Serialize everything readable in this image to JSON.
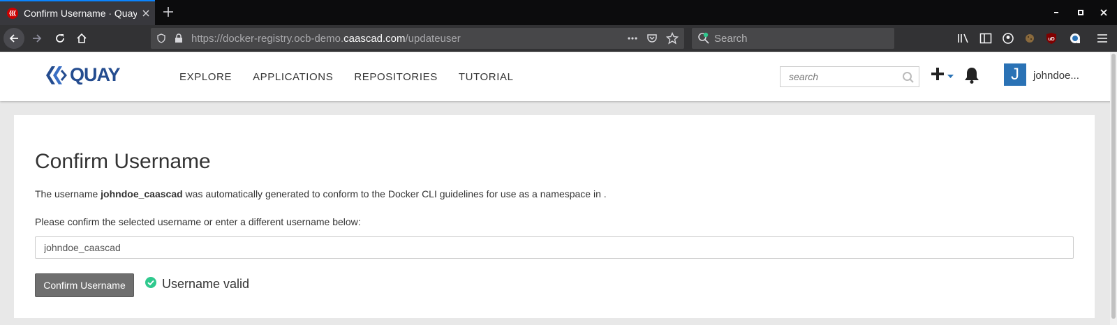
{
  "browser": {
    "tab_title": "Confirm Username · Quay",
    "url_prefix": "https://docker-registry.ocb-demo.",
    "url_domain": "caascad.com",
    "url_path": "/updateuser",
    "search_placeholder": "Search"
  },
  "header": {
    "logo_text": "QUAY",
    "nav": [
      "EXPLORE",
      "APPLICATIONS",
      "REPOSITORIES",
      "TUTORIAL"
    ],
    "search_placeholder": "search",
    "avatar_letter": "J",
    "username": "johndoe..."
  },
  "main": {
    "title": "Confirm Username",
    "desc_prefix": "The username ",
    "generated_username": "johndoe_caascad",
    "desc_suffix": " was automatically generated to conform to the Docker CLI guidelines for use as a namespace in .",
    "prompt": "Please confirm the selected username or enter a different username below:",
    "input_value": "johndoe_caascad",
    "confirm_label": "Confirm Username",
    "status": "Username valid"
  },
  "colors": {
    "accent": "#0a84ff",
    "brand": "#244c8f",
    "valid": "#2fc98e",
    "avatar": "#2a72b5"
  }
}
